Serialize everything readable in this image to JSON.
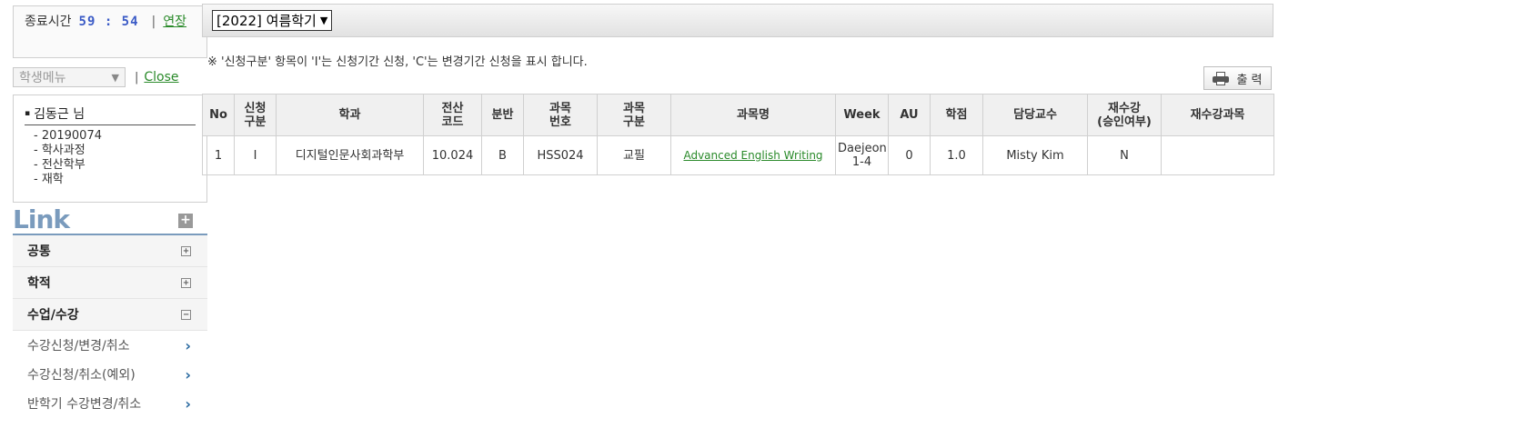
{
  "timer": {
    "label": "종료시간",
    "value": "59 : 54",
    "separator": "|",
    "extend_label": "연장"
  },
  "menu": {
    "select_value": "학생메뉴",
    "separator": "|",
    "close_label": "Close"
  },
  "user": {
    "name": "김동근 님",
    "info": [
      "- 20190074",
      "- 학사과정",
      "- 전산학부",
      "- 재학"
    ]
  },
  "links": {
    "title": "Link",
    "expand_symbol": "+",
    "categories": [
      {
        "label": "공통",
        "toggle": "+"
      },
      {
        "label": "학적",
        "toggle": "+"
      },
      {
        "label": "수업/수강",
        "toggle": "−"
      }
    ],
    "subitems": [
      {
        "label": "수강신청/변경/취소",
        "arrow": "›"
      },
      {
        "label": "수강신청/취소(예외)",
        "arrow": "›"
      },
      {
        "label": "반학기 수강변경/취소",
        "arrow": "›"
      }
    ]
  },
  "semester_select": {
    "value": "[2022] 여름학기"
  },
  "notice": "※ '신청구분' 항목이 'I'는 신청기간 신청, 'C'는 변경기간 신청을 표시 합니다.",
  "print_button": {
    "label": "출 력"
  },
  "table": {
    "headers": [
      "No",
      "신청\n구분",
      "학과",
      "전산\n코드",
      "분반",
      "과목\n번호",
      "과목\n구분",
      "과목명",
      "Week",
      "AU",
      "학점",
      "담당교수",
      "재수강\n(승인여부)",
      "재수강과목"
    ],
    "rows": [
      {
        "no": "1",
        "type": "I",
        "dept": "디지털인문사회과학부",
        "code": "10.024",
        "section": "B",
        "course_no": "HSS024",
        "category": "교필",
        "course_name": "Advanced English Writing",
        "week": "Daejeon\n1-4",
        "au": "0",
        "credit": "1.0",
        "professor": "Misty Kim",
        "retake": "N",
        "retake_course": ""
      }
    ]
  },
  "colors": {
    "accent_blue": "#7a9bbd",
    "link_green": "#2a8a2a",
    "timer_blue": "#3b5bc6"
  }
}
